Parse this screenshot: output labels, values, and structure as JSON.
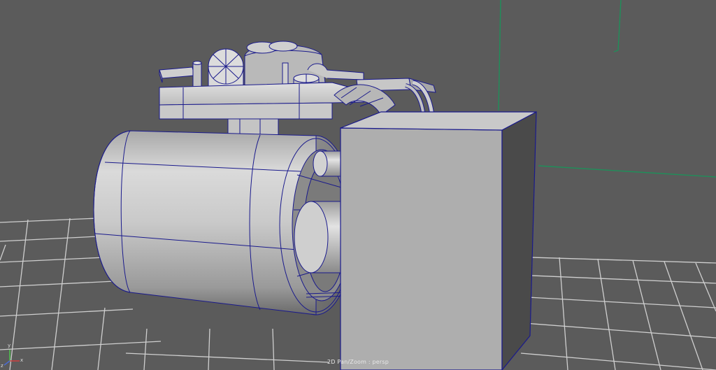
{
  "viewport": {
    "camera_label": "2D Pan/Zoom : persp",
    "axis_labels": {
      "x": "x",
      "y": "y",
      "z": "z"
    }
  },
  "colors": {
    "background": "#5b5b5b",
    "grid": "#cfcfcf",
    "axis_green": "#1f8f5a",
    "wireframe": "#1a1a8c",
    "mesh_light": "#d4d4d4",
    "mesh_mid": "#a9a9a9",
    "mesh_dark": "#6e6e6e",
    "box_front": "#aeaeae",
    "box_side": "#4a4a4a"
  }
}
